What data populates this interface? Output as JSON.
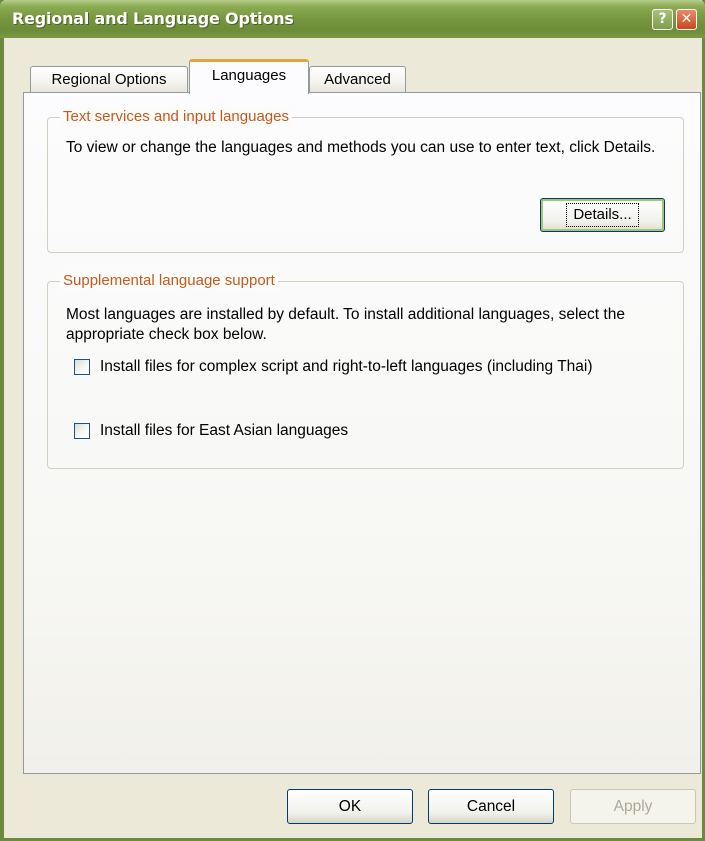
{
  "window": {
    "title": "Regional and Language Options",
    "help_glyph": "?",
    "close_glyph": "✕"
  },
  "tabs": [
    {
      "label": "Regional Options",
      "selected": false
    },
    {
      "label": "Languages",
      "selected": true
    },
    {
      "label": "Advanced",
      "selected": false
    }
  ],
  "text_services": {
    "legend": "Text services and input languages",
    "description": "To view or change the languages and methods you can use to enter text, click Details.",
    "details_button": "Details..."
  },
  "supplemental": {
    "legend": "Supplemental language support",
    "description": "Most languages are installed by default. To install additional languages, select the appropriate check box below.",
    "checkbox_complex": {
      "label": "Install files for complex script and right-to-left languages (including Thai)",
      "checked": false
    },
    "checkbox_east_asian": {
      "label": "Install files for East Asian languages",
      "checked": false
    }
  },
  "buttons": {
    "ok": "OK",
    "cancel": "Cancel",
    "apply": "Apply"
  },
  "colors": {
    "title_bar": "#76963f",
    "groupbox_legend": "#c4591d",
    "selected_tab_accent": "#e8a33c"
  }
}
